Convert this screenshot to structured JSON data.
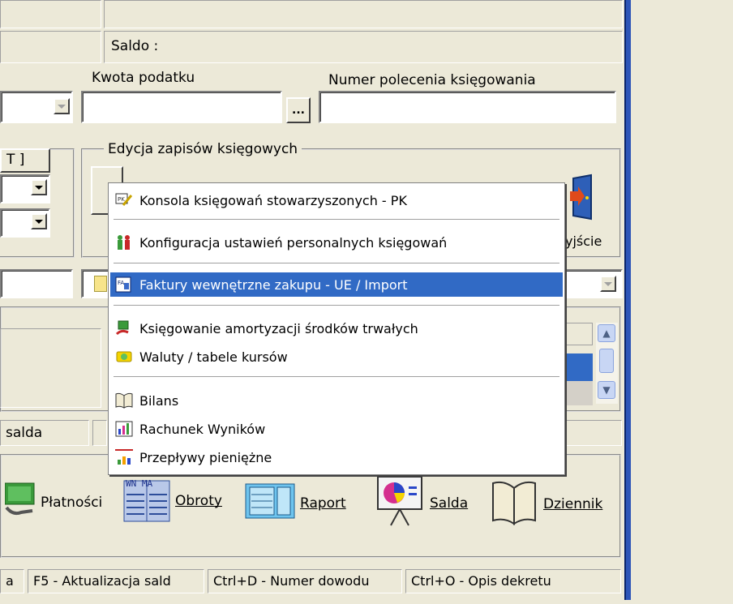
{
  "form": {
    "saldo_label": "Saldo :",
    "tax_amount_label": "Kwota podatku",
    "posting_order_label": "Numer polecenia księgowania",
    "ellipsis_label": "...",
    "edit_group_label": "Edycja zapisów księgowych",
    "bracket_tab_label": "T ]",
    "exit_label": "yjście",
    "saldo_tab_label": "salda"
  },
  "menu": {
    "items": [
      {
        "label": "Konsola księgowań stowarzyszonych - PK",
        "icon": "console-icon"
      },
      {
        "label": "Konfiguracja ustawień personalnych księgowań",
        "icon": "people-config-icon"
      },
      {
        "label": "Faktury wewnętrzne zakupu - UE / Import",
        "icon": "invoice-icon"
      },
      {
        "label": "Księgowanie amortyzacji środków trwałych",
        "icon": "depreciation-icon"
      },
      {
        "label": "Waluty / tabele kursów",
        "icon": "currency-icon"
      },
      {
        "label": "Bilans",
        "icon": "balance-book-icon"
      },
      {
        "label": "Rachunek Wyników",
        "icon": "income-chart-icon"
      },
      {
        "label": "Przepływy pieniężne",
        "icon": "cashflow-chart-icon"
      }
    ],
    "highlighted_index": 2
  },
  "toolbar": {
    "platnosci": {
      "label": "Płatności",
      "accel": "P"
    },
    "obroty": {
      "label": "Obroty",
      "accel": "O",
      "icon_text": "WN MA"
    },
    "raport": {
      "label": "Raport",
      "accel": "R"
    },
    "salda": {
      "label": "Salda",
      "accel": "S"
    },
    "dziennik": {
      "label": "Dziennik",
      "accel": "D"
    }
  },
  "statusbar": {
    "cell0": "a",
    "cell1": "F5 - Aktualizacja sald",
    "cell2": "Ctrl+D - Numer dowodu",
    "cell3": "Ctrl+O - Opis dekretu"
  },
  "colors": {
    "highlight": "#316ac5",
    "window_frame": "#2d55b8",
    "face": "#ece9d8"
  }
}
